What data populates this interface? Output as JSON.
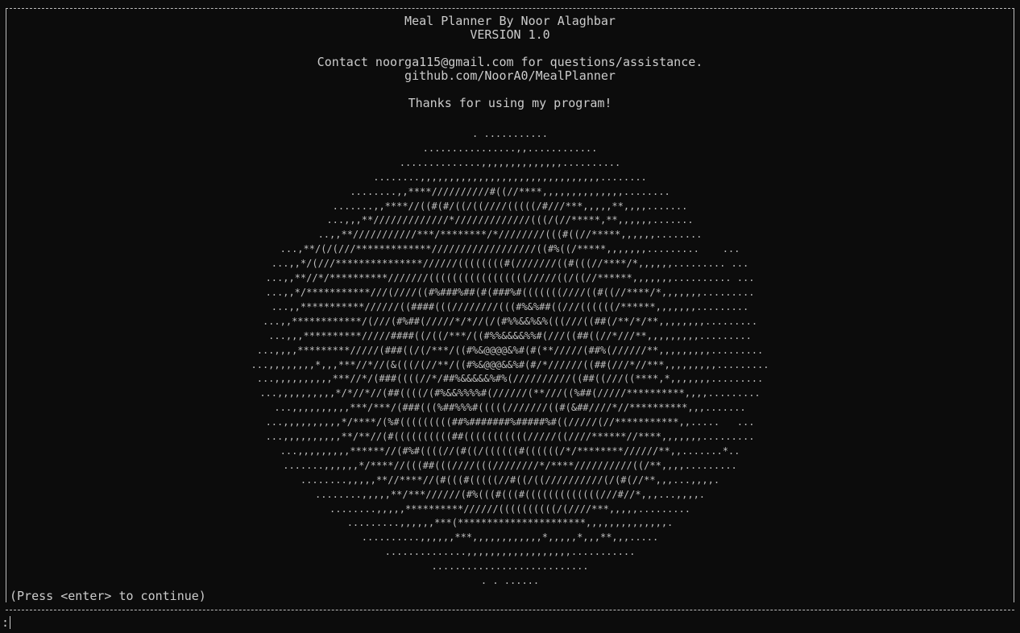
{
  "header": {
    "title": "Meal Planner By Noor Alaghbar",
    "version": "VERSION 1.0",
    "contact": "Contact noorga115@gmail.com for questions/assistance.",
    "github": "github.com/NoorA0/MealPlanner",
    "thanks": "Thanks for using my program!"
  },
  "ascii_art": [
    ". ...........",
    "................,,............",
    "..............,,,,,,,,,,,,,,..........",
    "........,,,,,,,,,,,,,,,,,,,,,,,,,,,,,,,........",
    "........,,****//////////#((//****,,,,,,,,,,,,,,........",
    ".......,,****//((#(#/((/((////(((((/#///***,,,,,**,,,,.......",
    "...,,,**/////////////*/////////////(((/(//*****,**,,,,,,.......",
    "..,,**///////////***/********/*////////(((#((//*****,,,,,,........",
    "...,**/(/(///*************//////////////////((#%((/*****,,,,,,,.........    ...",
    "...,,*/(///***************//////((((((((#(///////((#(((//****/*,,,,,,......... ...",
    "...,,**//*/**********///////(((((((((((((((((/////((/((//******,,,,,,,.......... ...",
    "...,,*/***********///(////((#%###%##(#(###%#(((((((////((#((//****/*,,,,,,,.........",
    "...,,***********//////((####(((////////(((#%&%##((///((((((/******,,,,,,,.........",
    "...,,************/(///(#%##(/////*/*//(/(#%%&&%&%(((///((##(/**/*/**,,,,,,,,.........",
    "...,,,**********/////####((/((/***/((#%%&&&&%%#(///((##((//*///**,,,,,,,,,.........",
    "...,,,,*********/////(###((/(/***/((#%&@@@@&%#(#(**/////(##%(//////**,,,,,,,,,.........",
    "...,,,,,,,,*,,,***//*//(&(((/(//**/((#%&@@@&&%#(#/*//////((##(///*//***,,,,,,,,,.........",
    "...,,,,,,,,,,***//*/(###((((//*/##%&&&&&%#%(//////////((##((///((****,*,,,,,,,.........",
    "...,,,,,,,,,,*/*//*//(##((((/(#%&&%%%%#(//////(**///((%##(/////**********,,,,.........",
    "...,,,,,,,,,,***/***/(###(((%##%%%#(((((///////((#(&##////*//**********,,,.......",
    "...,,,,,,,,,,*/****/(%#(((((((((##%#######%#####%#((/////(//***********,,.....   ...",
    "...,,,,,,,,,,**/**//(#((((((((((##(((((((((((/////((////******//****,,,,,,,.........",
    "...,,,,,,,,,******//(#%#((((//(#((/((((((#((((((/*/********//////**,,.......*..",
    ".......,,,,,,*/****//(((##(((////(((////////*/****//////////((/**,,,,.........",
    "........,,,,,**//****//(#(((#(((((//#((/((//////////(/(#(//**,,,...,,,,.",
    "........,,,,,**/***//////(#%(((#(((#(((((((((((((///#//*,,,...,,,,.",
    "........,,,,,**********//////((((((((((/(////***,,,,,.........",
    ".........,,,,,,***(**********************,,,,,,,,,,,,,,.",
    "..........,,,,,,***,,,,,,,,,,,,*,,,,,*,,,**,,,.....",
    "..............,,,,,,,,,,,,,,,,,,...........",
    "...........................",
    ". . ......"
  ],
  "footer": {
    "continue_text": "(Press <enter> to continue)",
    "prompt": ":"
  }
}
